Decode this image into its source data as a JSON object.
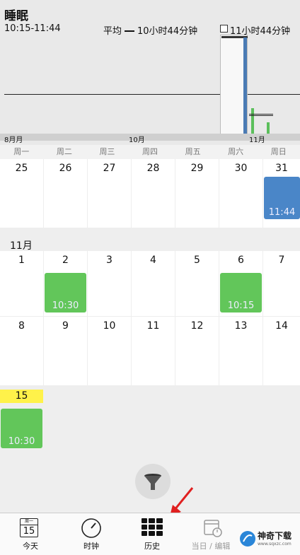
{
  "header": {
    "title": "睡眠",
    "time_range": "10:15-11:44",
    "average_label": "平均",
    "average_value": "10小时44分钟",
    "selection_label": "11小时44分钟"
  },
  "chart_axis": {
    "labels": [
      "8月月",
      "10月",
      "11月"
    ]
  },
  "weekdays": [
    "周一",
    "周二",
    "周三",
    "周四",
    "周五",
    "周六",
    "周日"
  ],
  "calendar": {
    "week1": [
      "25",
      "26",
      "27",
      "28",
      "29",
      "30",
      "31"
    ],
    "month_label": "11月",
    "week2": [
      "1",
      "2",
      "3",
      "4",
      "5",
      "6",
      "7"
    ],
    "week3": [
      "8",
      "9",
      "10",
      "11",
      "12",
      "13",
      "14"
    ],
    "week4": [
      "15"
    ],
    "events": {
      "oct31": "11:44",
      "nov2": "10:30",
      "nov6": "10:15",
      "nov15": "10:30"
    }
  },
  "colors": {
    "event_green": "#62c65a",
    "event_blue": "#4a86c8",
    "today_highlight": "#fff24a"
  },
  "tabbar": {
    "today_icon_day": "15",
    "today_icon_week": "周一",
    "today_label": "今天",
    "clock_label": "时钟",
    "history_label": "历史",
    "edit_label": "当日 / 编辑"
  },
  "watermark": {
    "brand_text": "神奇下载",
    "site_text": "www.sqxzc.com"
  }
}
